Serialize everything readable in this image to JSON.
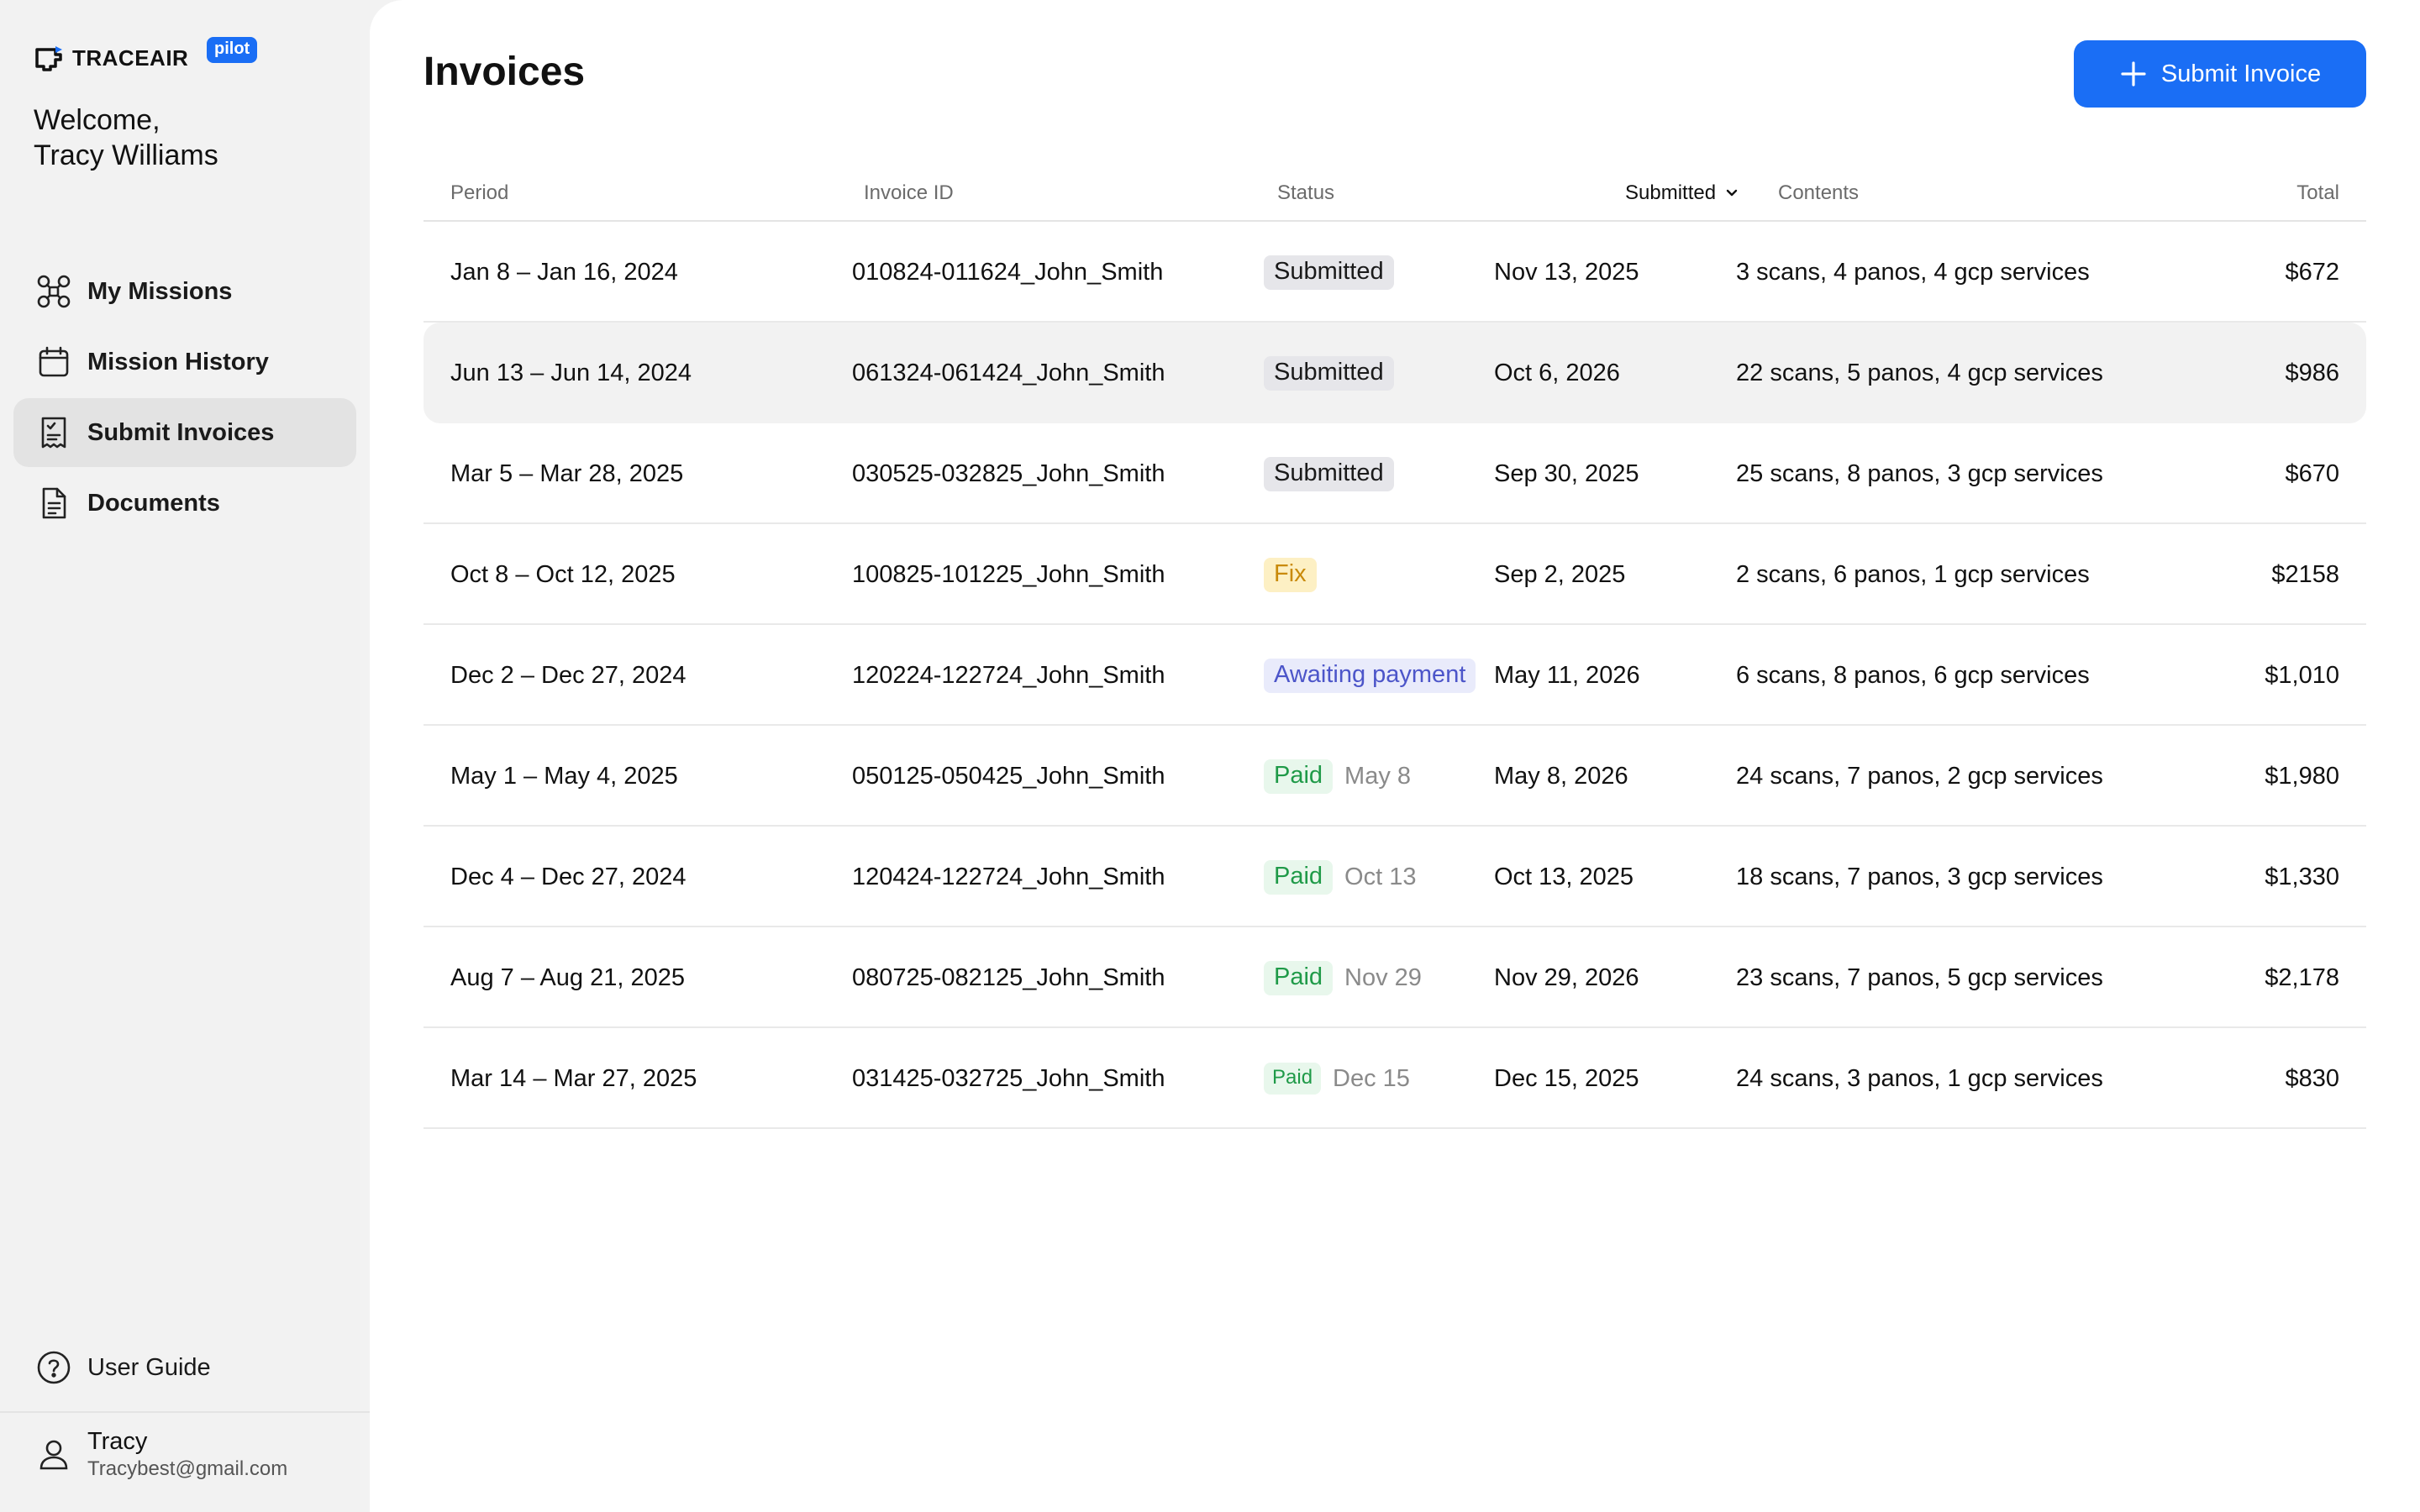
{
  "brand": {
    "name": "TRACEAIR",
    "badge": "pilot"
  },
  "welcome": {
    "line1": "Welcome,",
    "line2": "Tracy Williams"
  },
  "nav": [
    {
      "label": "My Missions",
      "icon": "drone-icon",
      "active": false
    },
    {
      "label": "Mission History",
      "icon": "calendar-icon",
      "active": false
    },
    {
      "label": "Submit Invoices",
      "icon": "invoice-icon",
      "active": true
    },
    {
      "label": "Documents",
      "icon": "document-icon",
      "active": false
    }
  ],
  "footer": {
    "guide_label": "User Guide",
    "user_name": "Tracy",
    "user_email": "Tracybest@gmail.com"
  },
  "page": {
    "title": "Invoices",
    "submit_label": "Submit Invoice"
  },
  "table": {
    "columns": {
      "period": "Period",
      "invoice_id": "Invoice ID",
      "status": "Status",
      "submitted": "Submitted",
      "contents": "Contents",
      "total": "Total"
    },
    "sorted_by": "submitted",
    "rows": [
      {
        "period": "Jan 8 – Jan 16, 2024",
        "invoice_id": "010824-011624_John_Smith",
        "status": "Submitted",
        "status_type": "submitted",
        "paid_date": "",
        "submitted": "Nov 13, 2025",
        "contents": "3 scans, 4 panos, 4 gcp services",
        "total": "$672"
      },
      {
        "period": "Jun 13 – Jun 14, 2024",
        "invoice_id": "061324-061424_John_Smith",
        "status": "Submitted",
        "status_type": "submitted",
        "paid_date": "",
        "submitted": "Oct 6, 2026",
        "contents": "22 scans, 5 panos, 4 gcp services",
        "total": "$986"
      },
      {
        "period": "Mar 5 – Mar 28, 2025",
        "invoice_id": "030525-032825_John_Smith",
        "status": "Submitted",
        "status_type": "submitted",
        "paid_date": "",
        "submitted": "Sep 30, 2025",
        "contents": "25 scans, 8 panos, 3 gcp services",
        "total": "$670"
      },
      {
        "period": "Oct 8 – Oct 12, 2025",
        "invoice_id": "100825-101225_John_Smith",
        "status": "Fix",
        "status_type": "fix",
        "paid_date": "",
        "submitted": "Sep 2, 2025",
        "contents": "2 scans, 6 panos, 1 gcp services",
        "total": "$2158"
      },
      {
        "period": "Dec 2 – Dec 27, 2024",
        "invoice_id": "120224-122724_John_Smith",
        "status": "Awaiting payment",
        "status_type": "awaiting",
        "paid_date": "",
        "submitted": "May 11, 2026",
        "contents": "6 scans, 8 panos, 6 gcp services",
        "total": "$1,010"
      },
      {
        "period": "May 1 – May 4, 2025",
        "invoice_id": "050125-050425_John_Smith",
        "status": "Paid",
        "status_type": "paid",
        "paid_date": "May 8",
        "submitted": "May 8, 2026",
        "contents": "24 scans, 7 panos, 2 gcp services",
        "total": "$1,980"
      },
      {
        "period": "Dec 4 – Dec 27, 2024",
        "invoice_id": "120424-122724_John_Smith",
        "status": "Paid",
        "status_type": "paid",
        "paid_date": "Oct 13",
        "submitted": "Oct 13, 2025",
        "contents": "18 scans, 7 panos, 3 gcp services",
        "total": "$1,330"
      },
      {
        "period": "Aug 7 – Aug 21, 2025",
        "invoice_id": "080725-082125_John_Smith",
        "status": "Paid",
        "status_type": "paid",
        "paid_date": "Nov 29",
        "submitted": "Nov 29, 2026",
        "contents": "23 scans, 7 panos, 5 gcp services",
        "total": "$2,178"
      },
      {
        "period": "Mar 14 – Mar 27, 2025",
        "invoice_id": "031425-032725_John_Smith",
        "status": "Paid",
        "status_type": "paid-small",
        "paid_date": "Dec 15",
        "submitted": "Dec 15, 2025",
        "contents": "24 scans, 3 panos, 1 gcp services",
        "total": "$830"
      }
    ]
  },
  "colors": {
    "accent": "#1a6ef5",
    "sidebar_bg": "#f2f2f2",
    "paid": "#1f9a48",
    "fix": "#c98a0a",
    "awaiting": "#4c55c9"
  }
}
